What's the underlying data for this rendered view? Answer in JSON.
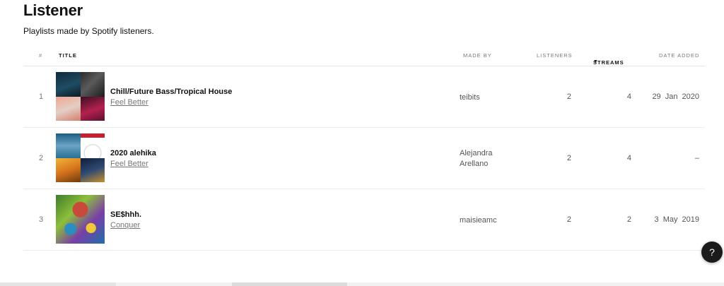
{
  "page": {
    "title": "Listener",
    "subtitle": "Playlists made by Spotify listeners."
  },
  "table": {
    "columns": {
      "num": "#",
      "title": "TITLE",
      "made_by": "MADE BY",
      "listeners": "LISTENERS",
      "streams": "STREAMS",
      "date_added": "DATE ADDED"
    },
    "sorted_column": "streams",
    "sort_direction": "descending",
    "rows": [
      {
        "num": "1",
        "name": "Chill/Future Bass/Tropical House",
        "genre": "Feel Better",
        "made_by": [
          "teibits"
        ],
        "listeners": "2",
        "streams": "4",
        "date_added": "29 Jan 2020"
      },
      {
        "num": "2",
        "name": "2020 alehika",
        "genre": "Feel Better",
        "made_by": [
          "Alejandra",
          "Arellano"
        ],
        "listeners": "2",
        "streams": "4",
        "date_added": "–"
      },
      {
        "num": "3",
        "name": "SE$hhh.",
        "genre": "Conquer",
        "made_by": [
          "maisieamc"
        ],
        "listeners": "2",
        "streams": "2",
        "date_added": "3 May 2019"
      }
    ]
  },
  "help_button": {
    "label": "?"
  },
  "icons": {
    "sort": "sort-down-icon",
    "help": "question-icon"
  }
}
